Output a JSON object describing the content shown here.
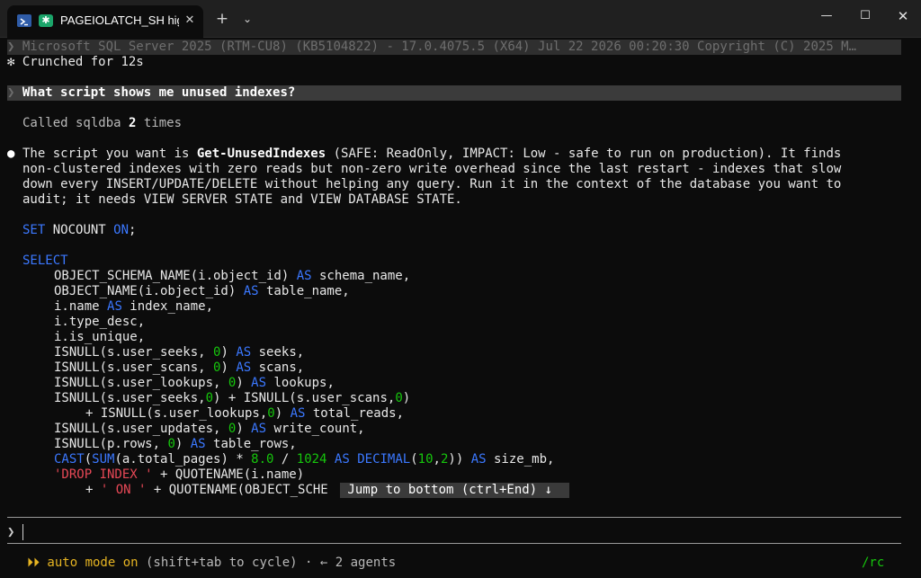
{
  "window": {
    "tab_title": "PAGEIOLATCH_SH high lat",
    "tab_close_glyph": "✕",
    "new_tab_glyph": "+",
    "dropdown_glyph": "⌄",
    "minimize_glyph": "—",
    "maximize_glyph": "☐",
    "close_glyph": "✕",
    "app_icon_glyph": "✱"
  },
  "banner": {
    "caret": "❯",
    "text": "Microsoft SQL Server 2025 (RTM-CU8) (KB5104822) - 17.0.4075.5 (X64) Jul 22 2026 00:20:30 Copyright (C) 2025 M…"
  },
  "crunched": {
    "glyph": "✻",
    "text": "Crunched for 12s"
  },
  "question": {
    "caret": "❯",
    "text": "What script shows me unused indexes?"
  },
  "called": {
    "prefix": "Called sqldba ",
    "count": "2",
    "suffix": " times"
  },
  "answer": {
    "bullet": "●",
    "line1_a": "The script you want is ",
    "line1_bold": "Get-UnusedIndexes",
    "line1_b": " (SAFE: ReadOnly, IMPACT: Low - safe to run on production). It finds",
    "line2": "non-clustered indexes with zero reads but non-zero write overhead since the last restart - indexes that slow",
    "line3": "down every INSERT/UPDATE/DELETE without helping any query. Run it in the context of the database you want to",
    "line4": "audit; it needs VIEW SERVER STATE and VIEW DATABASE STATE."
  },
  "code": {
    "set": "SET",
    "nocount": " NOCOUNT ",
    "on": "ON",
    "semi": ";",
    "select": "SELECT",
    "as": "AS",
    "l1": "OBJECT_SCHEMA_NAME(i.object_id) ",
    "l1b": " schema_name,",
    "l2": "OBJECT_NAME(i.object_id) ",
    "l2b": " table_name,",
    "l3": "i.name ",
    "l3b": " index_name,",
    "l4": "i.type_desc,",
    "l5": "i.is_unique,",
    "l6": "ISNULL(s.user_seeks, ",
    "l6b": ") ",
    "l6c": " seeks,",
    "l7": "ISNULL(s.user_scans, ",
    "l7b": ") ",
    "l7c": " scans,",
    "l8": "ISNULL(s.user_lookups, ",
    "l8b": ") ",
    "l8c": " lookups,",
    "l9": "ISNULL(s.user_seeks,",
    "l9b": ") + ISNULL(s.user_scans,",
    "l9c": ")",
    "l10": "+ ISNULL(s.user_lookups,",
    "l10b": ") ",
    "l10c": " total_reads,",
    "l11": "ISNULL(s.user_updates, ",
    "l11b": ") ",
    "l11c": " write_count,",
    "l12": "ISNULL(p.rows, ",
    "l12b": ") ",
    "l12c": " table_rows,",
    "cast": "CAST",
    "sum": "SUM",
    "l13a": "(",
    "l13b": "(a.total_pages) * ",
    "eight": "8.0",
    "l13c": " / ",
    "k1024": "1024",
    "l13d": " ",
    "decimal": "DECIMAL",
    "l13e": "(",
    "ten": "10",
    "l13f": ",",
    "two": "2",
    "l13g": ")) ",
    "l13h": " size_mb,",
    "drop_str": "'DROP INDEX '",
    "l14b": " + QUOTENAME(i.name)",
    "l15a": "+ ",
    "on_str": "' ON '",
    "l15b": " + QUOTENAME(OBJECT_SCHE",
    "zero": "0"
  },
  "jump": {
    "text": " Jump to bottom (ctrl+End) ↓ "
  },
  "prompt": {
    "caret": "❯"
  },
  "status": {
    "arrows": "⏵⏵",
    "mode": " auto mode on",
    "hint": " (shift+tab to cycle)",
    "dot": " · ",
    "left_arrow": "←",
    "agents": " 2 agents",
    "rc": "/rc"
  }
}
